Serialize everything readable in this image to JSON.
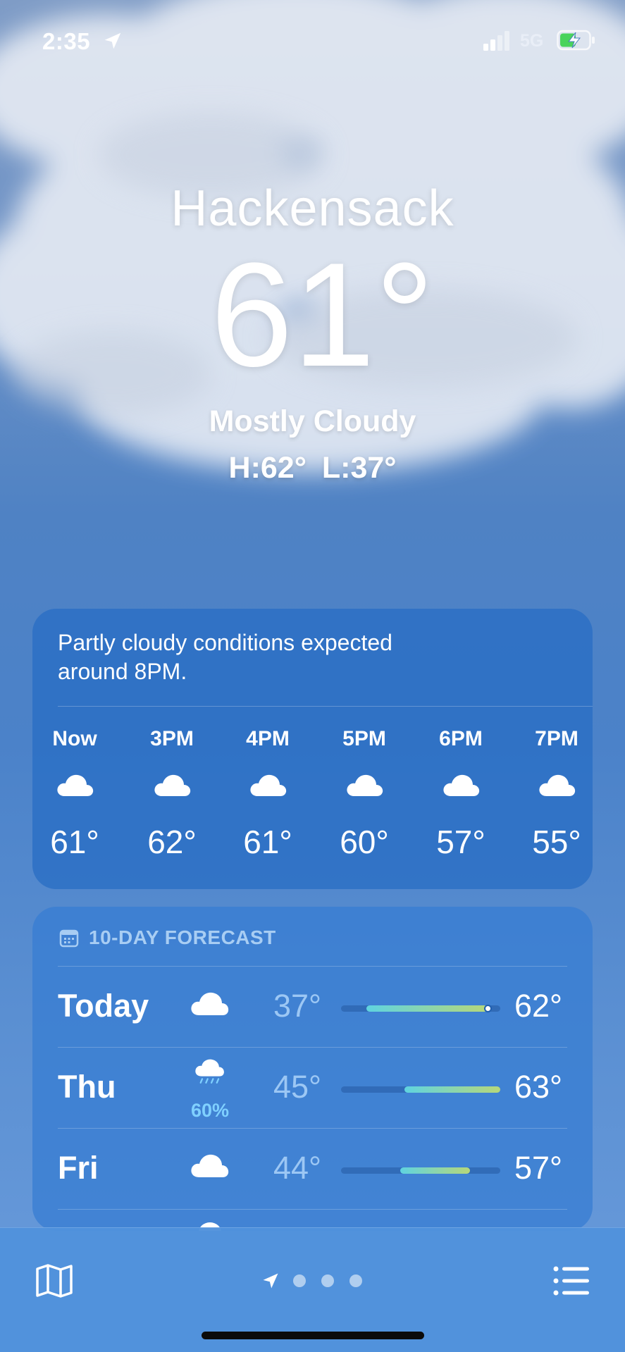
{
  "status_bar": {
    "time": "2:35",
    "network": "5G",
    "location_icon": "location-arrow-icon",
    "signal_icon": "cellular-signal-icon",
    "battery_icon": "battery-charging-icon"
  },
  "location": {
    "city": "Hackensack",
    "temperature": "61°",
    "condition": "Mostly Cloudy",
    "high_low": "H:62° L:37°"
  },
  "hourly": {
    "summary": "Partly cloudy conditions expected around 8PM.",
    "hours": [
      {
        "label": "Now",
        "icon": "cloud-icon",
        "temp": "61°"
      },
      {
        "label": "3PM",
        "icon": "cloud-icon",
        "temp": "62°"
      },
      {
        "label": "4PM",
        "icon": "cloud-icon",
        "temp": "61°"
      },
      {
        "label": "5PM",
        "icon": "cloud-icon",
        "temp": "60°"
      },
      {
        "label": "6PM",
        "icon": "cloud-icon",
        "temp": "57°"
      },
      {
        "label": "7PM",
        "icon": "cloud-icon",
        "temp": "55°"
      }
    ]
  },
  "forecast": {
    "title": "10-DAY FORECAST",
    "header_icon": "calendar-icon",
    "days": [
      {
        "day": "Today",
        "icon": "cloud-icon",
        "precip": "",
        "low": "37°",
        "high": "62°",
        "range_start": 0.16,
        "range_end": 0.92,
        "current": 0.92
      },
      {
        "day": "Thu",
        "icon": "cloud-rain-icon",
        "precip": "60%",
        "low": "45°",
        "high": "63°",
        "range_start": 0.4,
        "range_end": 1.0
      },
      {
        "day": "Fri",
        "icon": "cloud-icon",
        "precip": "",
        "low": "44°",
        "high": "57°",
        "range_start": 0.37,
        "range_end": 0.81
      }
    ]
  },
  "toolbar": {
    "map_icon": "map-icon",
    "location_icon": "location-arrow-icon",
    "page_count": 3,
    "list_icon": "list-icon"
  },
  "colors": {
    "sky_top": "#7f9cc6",
    "sky_bottom": "#6a9cdc",
    "card_hourly": "#2b6fc4",
    "card_forecast": "#387ed2",
    "range_cool": "#5fd3e0",
    "range_warm": "#b6d77a",
    "label_blue": "#a8cdf3"
  }
}
